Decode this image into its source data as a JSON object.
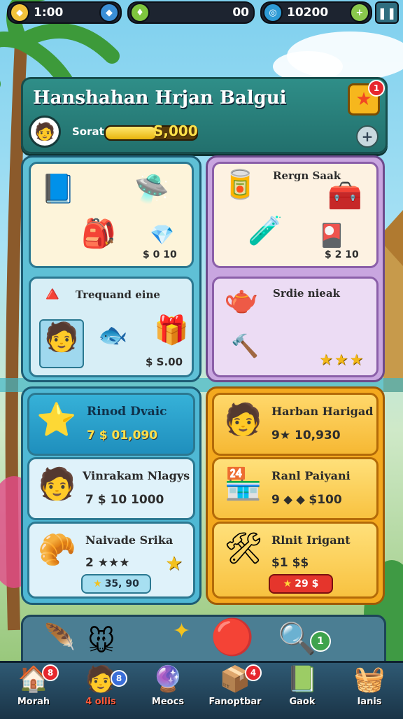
{
  "topbar": {
    "currency1": {
      "value": "1:00",
      "icon": "gem-icon"
    },
    "currency2": {
      "value": "00",
      "icon": "leaf-gem-icon"
    },
    "currency3": {
      "value": "10200",
      "icon": "coin-icon"
    }
  },
  "header": {
    "title": "Hanshahan Hrjan Balgui",
    "sort_label": "Sorat",
    "progress_value": "S,000",
    "progress_fraction": 0.55,
    "star_badge": "1"
  },
  "top_left_card": {
    "price": "$ 0 10"
  },
  "top_right_card": {
    "title": "Rergn Saak",
    "price": "$ 2 10"
  },
  "mid_left_card": {
    "title": "Trequand eine",
    "price": "$ S.00"
  },
  "mid_right_card": {
    "title": "Srdie nieak"
  },
  "left_list": [
    {
      "name": "Rinod Dvaic",
      "price": "7 $ 01,090"
    },
    {
      "name": "Vinrakam Nlagys",
      "price": "7 $ 10 1000"
    },
    {
      "name": "Naivade Srika",
      "price": "2 ★★★",
      "button": "35, 90"
    }
  ],
  "right_list": [
    {
      "name": "Harban Harigad",
      "price": "9★ 10,930"
    },
    {
      "name": "Ranl Paiyani",
      "price": "9 ⬥ ⬥ $100"
    },
    {
      "name": "Rlnit Irigant",
      "price": "$1 $$",
      "button": "29 $"
    }
  ],
  "nav": [
    {
      "label": "Morah",
      "icon": "house-icon",
      "badge": "8"
    },
    {
      "label": "4 ollis",
      "icon": "character-icon",
      "badge": "8"
    },
    {
      "label": "Meocs",
      "icon": "orb-icon",
      "badge": ""
    },
    {
      "label": "Fanoptbar",
      "icon": "chest-icon",
      "badge": "4"
    },
    {
      "label": "Gaok",
      "icon": "book-icon",
      "badge": ""
    },
    {
      "label": "Ianis",
      "icon": "crate-icon",
      "badge": ""
    }
  ],
  "tray_badge": "1"
}
